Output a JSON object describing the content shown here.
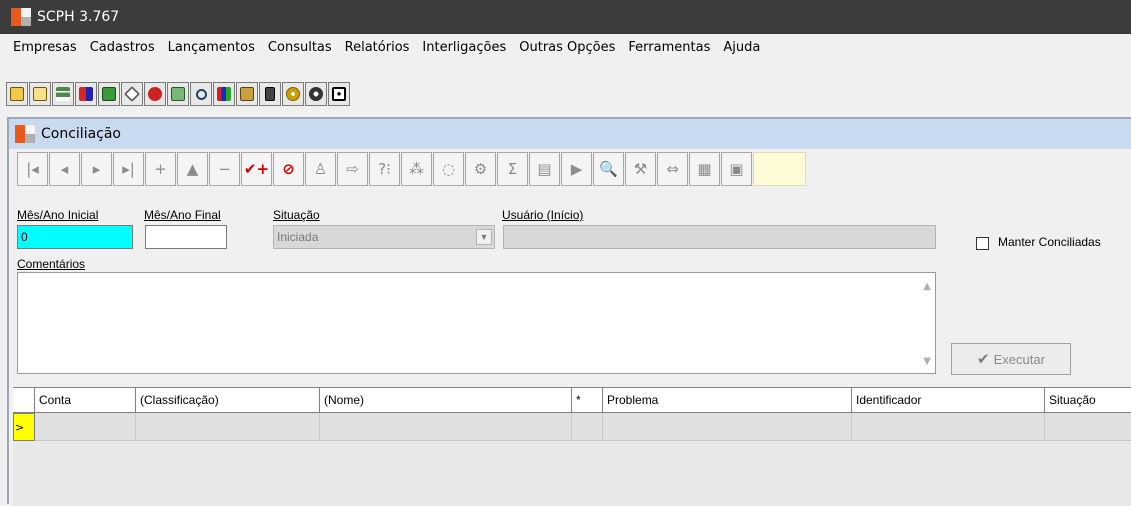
{
  "window": {
    "title": "SCPH 3.767"
  },
  "menu": [
    "Empresas",
    "Cadastros",
    "Lançamentos",
    "Consultas",
    "Relatórios",
    "Interligações",
    "Outras Opções",
    "Ferramentas",
    "Ajuda"
  ],
  "child": {
    "title": "Conciliação",
    "nav_buttons": [
      {
        "name": "first-record-button",
        "glyph": "|◂"
      },
      {
        "name": "prior-record-button",
        "glyph": "◂"
      },
      {
        "name": "next-record-button",
        "glyph": "▸"
      },
      {
        "name": "last-record-button",
        "glyph": "▸|"
      },
      {
        "name": "insert-record-button",
        "glyph": "+"
      },
      {
        "name": "edit-record-button",
        "glyph": "▲"
      },
      {
        "name": "delete-record-button",
        "glyph": "−"
      },
      {
        "name": "post-record-button",
        "glyph": "✔+",
        "red": true
      },
      {
        "name": "cancel-record-button",
        "glyph": "⊘",
        "red": true
      },
      {
        "name": "clear-button",
        "glyph": "♙"
      },
      {
        "name": "goto-button",
        "glyph": "⇨"
      },
      {
        "name": "help-button",
        "glyph": "?⁝"
      },
      {
        "name": "filter-button",
        "glyph": "⁂"
      },
      {
        "name": "refresh-button",
        "glyph": "◌"
      },
      {
        "name": "options-button",
        "glyph": "⚙"
      },
      {
        "name": "sum-button",
        "glyph": "Σ"
      },
      {
        "name": "copy-button",
        "glyph": "▤"
      },
      {
        "name": "export-button",
        "glyph": "▶"
      },
      {
        "name": "search-button",
        "glyph": "🔍"
      },
      {
        "name": "tools-button",
        "glyph": "⚒"
      },
      {
        "name": "link-button",
        "glyph": "⇔"
      },
      {
        "name": "calculator-button",
        "glyph": "▦"
      },
      {
        "name": "close-window-button",
        "glyph": "▣"
      }
    ],
    "labels": {
      "mes_ano_inicial": "Mês/Ano Inicial",
      "mes_ano_final": "Mês/Ano Final",
      "situacao": "Situação",
      "usuario": "Usuário (Início)",
      "comentarios": "Comentários",
      "manter_conciliadas": "Manter Conciliadas"
    },
    "fields": {
      "mes_ano_inicial": "0",
      "mes_ano_final": "",
      "situacao": "Iniciada",
      "usuario": "",
      "comentarios": ""
    },
    "executar_label": "Executar",
    "grid": {
      "columns": [
        "Conta",
        "(Classificação)",
        "(Nome)",
        "*",
        "Problema",
        "Identificador",
        "Situação"
      ],
      "row_indicator": ">"
    }
  }
}
